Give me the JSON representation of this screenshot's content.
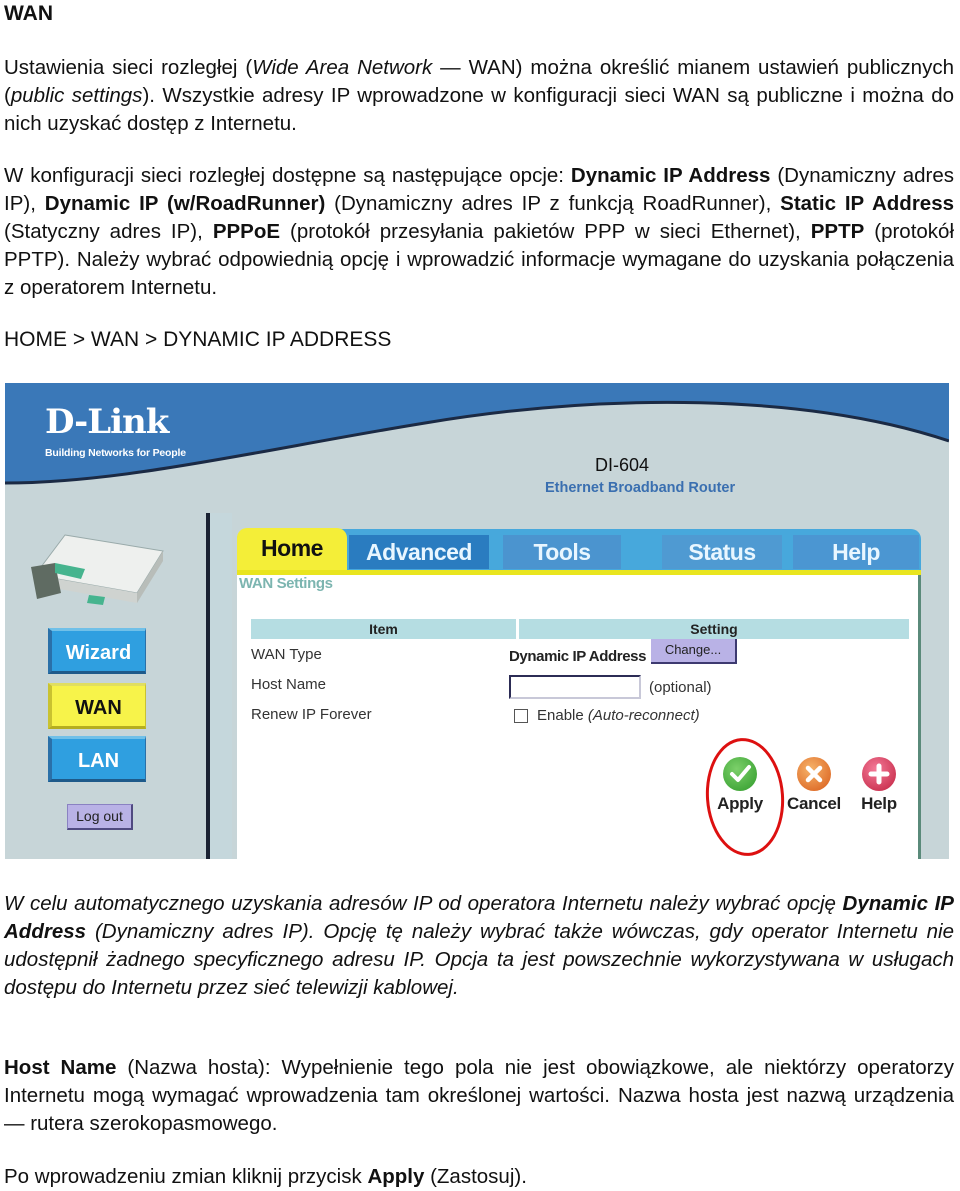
{
  "document": {
    "title": "WAN",
    "p1": {
      "a": "Ustawienia sieci rozległej (",
      "a_i": "Wide Area Network",
      "b": " — WAN) można określić mianem ustawień publicznych (",
      "b_i": "public settings",
      "c": "). Wszystkie adresy IP wprowadzone w konfiguracji sieci WAN są publiczne i można do nich uzyskać dostęp z Internetu."
    },
    "p2": {
      "t1": "W konfiguracji sieci rozległej dostępne są następujące opcje: ",
      "b1": "Dynamic IP Address",
      "t2": " (Dynamiczny adres IP), ",
      "b2": "Dynamic IP (w/RoadRunner)",
      "t3": " (Dynamiczny adres IP z funkcją RoadRunner), ",
      "b3": "Static IP Address",
      "t4": " (Statyczny adres IP), ",
      "b4": "PPPoE",
      "t5": " (protokół przesyłania pakietów PPP w sieci Ethernet), ",
      "b5": "PPTP",
      "t6": " (protokół PPTP). Należy wybrać odpowiednią opcję i wprowadzić informacje wymagane do uzyskania połączenia z operatorem Internetu."
    },
    "breadcrumb": "HOME > WAN > DYNAMIC IP ADDRESS",
    "p3": {
      "t1": "W celu automatycznego uzyskania adresów IP od operatora Internetu należy wybrać opcję ",
      "b1": "Dynamic IP Address",
      "t2": " (Dynamiczny adres IP). Opcję tę należy wybrać także wówczas, gdy operator Internetu nie udostępnił żadnego specyficznego adresu IP. Opcja ta jest powszechnie wykorzystywana w usługach dostępu do Internetu przez sieć telewizji kablowej."
    },
    "p4": {
      "b1": "Host Name",
      "t1": " (Nazwa hosta): Wypełnienie tego pola nie jest obowiązkowe, ale niektórzy operatorzy Internetu mogą wymagać wprowadzenia tam określonej wartości. Nazwa hosta jest nazwą urządzenia — rutera szerokopasmowego."
    },
    "p5": {
      "t1": "Po wprowadzeniu zmian kliknij przycisk ",
      "b1": "Apply",
      "t2": " (Zastosuj)."
    }
  },
  "router_ui": {
    "brand": "D-Link",
    "tagline": "Building Networks for People",
    "model": "DI-604",
    "model_desc": "Ethernet Broadband Router",
    "tabs": [
      {
        "label": "Home",
        "active": true
      },
      {
        "label": "Advanced",
        "active": false
      },
      {
        "label": "Tools",
        "active": false
      },
      {
        "label": "Status",
        "active": false
      },
      {
        "label": "Help",
        "active": false
      }
    ],
    "sidebar": [
      {
        "label": "Wizard",
        "active": false
      },
      {
        "label": "WAN",
        "active": true
      },
      {
        "label": "LAN",
        "active": false
      }
    ],
    "logout_label": "Log out",
    "section_title": "WAN Settings",
    "table": {
      "headers": [
        "Item",
        "Setting"
      ],
      "rows": [
        {
          "item": "WAN Type",
          "setting": "Dynamic IP Address"
        },
        {
          "item": "Host Name",
          "setting": ""
        },
        {
          "item": "Renew IP Forever",
          "setting": "Enable (Auto-reconnect)"
        }
      ]
    },
    "change_button": "Change...",
    "host_name_value": "",
    "optional_label": "(optional)",
    "renew_checkbox": {
      "checked": false,
      "label": "Enable",
      "label_hint": "(Auto-reconnect)"
    },
    "actions": [
      {
        "label": "Apply",
        "icon": "check-icon",
        "highlighted": true
      },
      {
        "label": "Cancel",
        "icon": "x-icon"
      },
      {
        "label": "Help",
        "icon": "plus-icon"
      }
    ],
    "colors": {
      "header_blue": "#3a78b8",
      "active_yellow": "#f4ee38",
      "tab_blue": "#47a8dc",
      "highlight_red": "#dd1010"
    }
  }
}
